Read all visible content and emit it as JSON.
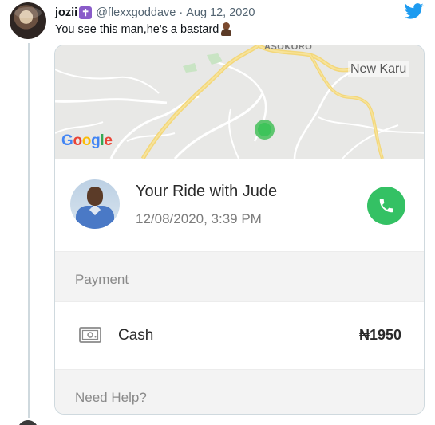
{
  "tweet": {
    "name": "jozii",
    "badge_glyph": "✝",
    "handle": "@flexxgoddave",
    "separator": "·",
    "date": "Aug 12, 2020",
    "text": "You see this man,he's a bastard",
    "emoji_icon": "person-shrugging-emoji-icon",
    "brand_color": "#1d9bf0"
  },
  "ride_card": {
    "map": {
      "top_label": "ASOKORO",
      "place_label": "New Karu",
      "logo_text": {
        "g1": "G",
        "o1": "o",
        "o2": "o",
        "g2": "g",
        "l": "l",
        "e": "e"
      },
      "location_color": "#3ec45a"
    },
    "ride": {
      "title": "Your Ride with Jude",
      "datetime": "12/08/2020, 3:39 PM",
      "call_icon": "phone-icon",
      "call_color": "#34c164"
    },
    "payment": {
      "section_label": "Payment",
      "method_icon": "cash-icon",
      "method_label": "Cash",
      "amount": "₦1950"
    },
    "help_label": "Need Help?"
  }
}
